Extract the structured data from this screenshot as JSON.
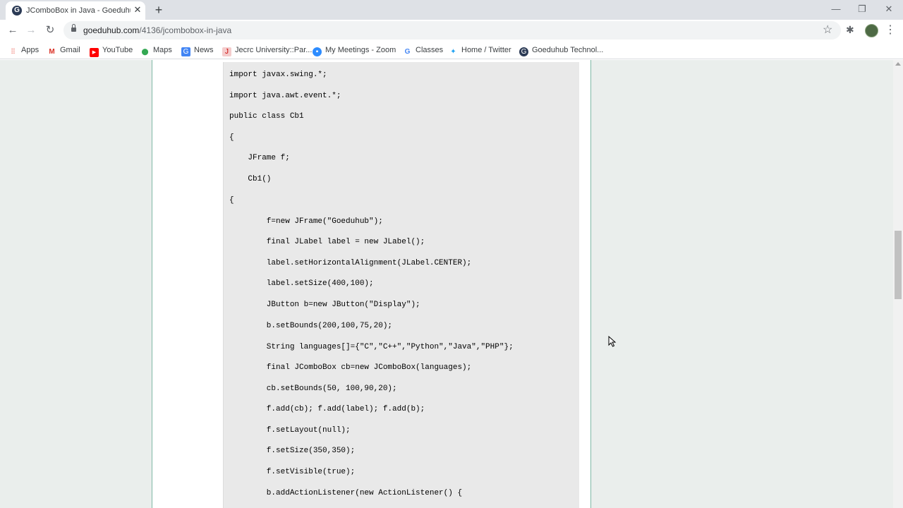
{
  "tab": {
    "favicon_letter": "G",
    "title": "JComboBox in Java - Goeduhub",
    "close": "✕",
    "new_tab": "+"
  },
  "window_controls": {
    "minimize": "—",
    "restore": "❐",
    "close": "✕"
  },
  "toolbar": {
    "back": "←",
    "forward": "→",
    "reload": "↻",
    "url_host": "goeduhub.com",
    "url_path": "/4136/jcombobox-in-java",
    "star": "☆",
    "extensions": "✱",
    "menu": "⋮"
  },
  "bookmarks": [
    {
      "label": "Apps",
      "icon": "apps-grid-icon",
      "glyph": "⁞⁞",
      "color": "#ea4335"
    },
    {
      "label": "Gmail",
      "icon": "gmail-icon",
      "glyph": "M",
      "color": "#d93025"
    },
    {
      "label": "YouTube",
      "icon": "youtube-icon",
      "glyph": "▶",
      "color": "#ff0000"
    },
    {
      "label": "Maps",
      "icon": "maps-pin-icon",
      "glyph": "⬤",
      "color": "#34a853"
    },
    {
      "label": "News",
      "icon": "news-icon",
      "glyph": "G",
      "color": "#4285f4"
    },
    {
      "label": "Jecrc University::Par...",
      "icon": "jecrc-icon",
      "glyph": "J",
      "color": "#e06666"
    },
    {
      "label": "My Meetings - Zoom",
      "icon": "zoom-icon",
      "glyph": "▪",
      "color": "#2d8cff"
    },
    {
      "label": "Classes",
      "icon": "google-icon",
      "glyph": "G",
      "color": "#4285f4"
    },
    {
      "label": "Home / Twitter",
      "icon": "twitter-icon",
      "glyph": "✦",
      "color": "#1da1f2"
    },
    {
      "label": "Goeduhub Technol...",
      "icon": "goeduhub-icon",
      "glyph": "G",
      "color": "#2b3a55"
    }
  ],
  "code_lines": [
    "import javax.swing.*;",
    "import java.awt.event.*;",
    "public class Cb1",
    "{",
    "    JFrame f;",
    "    Cb1()",
    "{",
    "        f=new JFrame(\"Goeduhub\");",
    "        final JLabel label = new JLabel();",
    "        label.setHorizontalAlignment(JLabel.CENTER);",
    "        label.setSize(400,100);",
    "        JButton b=new JButton(\"Display\");",
    "        b.setBounds(200,100,75,20);",
    "        String languages[]={\"C\",\"C++\",\"Python\",\"Java\",\"PHP\"};",
    "        final JComboBox cb=new JComboBox(languages);",
    "        cb.setBounds(50, 100,90,20);",
    "        f.add(cb); f.add(label); f.add(b);",
    "        f.setLayout(null);",
    "        f.setSize(350,350);",
    "        f.setVisible(true);",
    "        b.addActionListener(new ActionListener() {"
  ]
}
